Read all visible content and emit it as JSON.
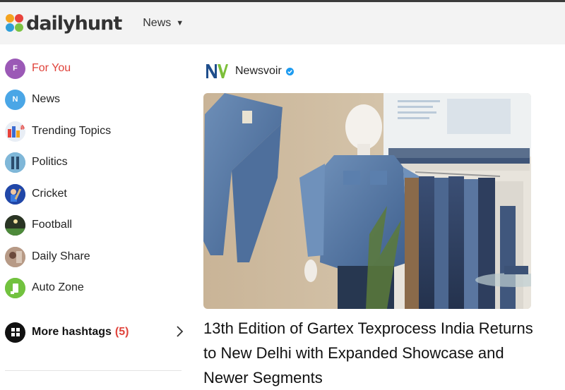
{
  "header": {
    "logo_text": "dailyhunt",
    "nav_label": "News",
    "nav_caret": "▼"
  },
  "sidebar": {
    "items": [
      {
        "label": "For You",
        "icon": "F",
        "icon_name": "for-you-icon",
        "active": true
      },
      {
        "label": "News",
        "icon": "N",
        "icon_name": "news-icon"
      },
      {
        "label": "Trending Topics",
        "icon": "",
        "icon_name": "trending-topics-icon"
      },
      {
        "label": "Politics",
        "icon": "",
        "icon_name": "politics-icon"
      },
      {
        "label": "Cricket",
        "icon": "",
        "icon_name": "cricket-icon"
      },
      {
        "label": "Football",
        "icon": "",
        "icon_name": "football-icon"
      },
      {
        "label": "Daily Share",
        "icon": "",
        "icon_name": "daily-share-icon"
      },
      {
        "label": "Auto Zone",
        "icon": "",
        "icon_name": "auto-zone-icon"
      }
    ],
    "more_label": "More hashtags",
    "more_count": "(5)"
  },
  "article": {
    "source_name": "Newsvoir",
    "source_logo": "NV",
    "headline": "13th Edition of Gartex Texprocess India Returns to New Delhi with Expanded Showcase and Newer Segments"
  },
  "colors": {
    "accent_red": "#e0433b",
    "header_bg": "#f3f3f3",
    "verified_blue": "#1d9bf0"
  }
}
